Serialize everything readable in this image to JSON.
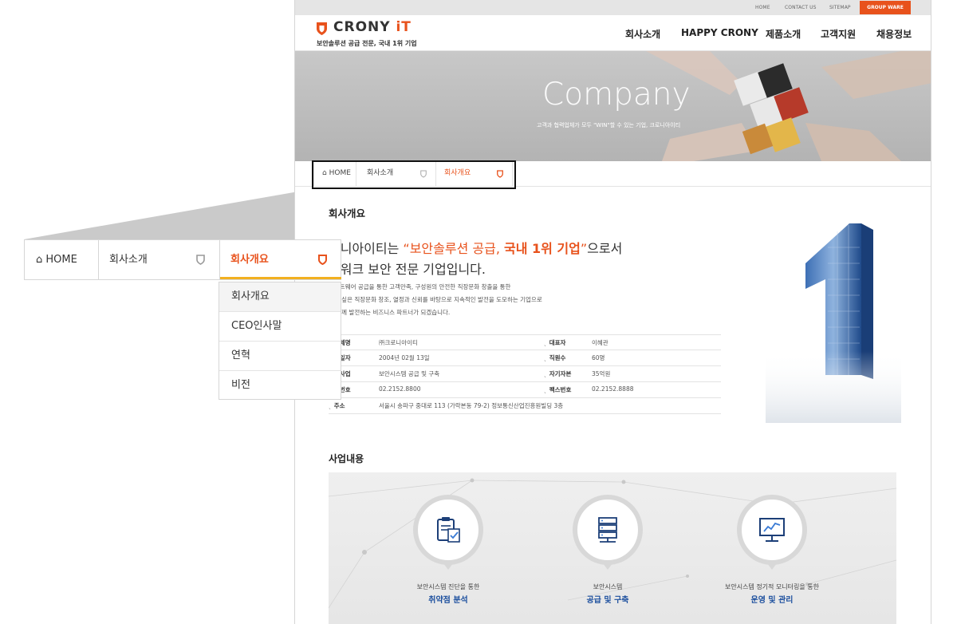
{
  "util": {
    "home": "HOME",
    "contact": "CONTACT US",
    "sitemap": "SITEMAP",
    "group_ware": "GROUP WARE"
  },
  "logo": {
    "name_main": "CRONY ",
    "name_it": "iT",
    "tagline": "보안솔루션 공급 전문, 국내 1위 기업"
  },
  "gnb": [
    "회사소개",
    "HAPPY CRONY",
    "제품소개",
    "고객지원",
    "채용정보"
  ],
  "hero": {
    "title": "Company",
    "subtitle": "고객과 협력업체가 모두 \"WIN\"할 수 있는 기업, 크로니아이티"
  },
  "breadcrumb": {
    "home": "HOME",
    "level1": "회사소개",
    "level2": "회사개요"
  },
  "dropdown": [
    "회사개요",
    "CEO인사말",
    "연혁",
    "비전"
  ],
  "content": {
    "title": "회사개요",
    "headline_pre": "로니아이티는 ",
    "headline_q1": "“보안솔루션 공급, ",
    "headline_bold": "국내 1위 기업",
    "headline_q2": "”",
    "headline_post": "으로서",
    "headline_line2": "트워크 보안 전문 기업입니다.",
    "desc1": "소프트웨어 공급을 통한 고객만족, 구성원의  안전한 직장문화 창출을 통한",
    "desc2": "하고 싶은 직장문화 창조, 열정과 신뢰를 바탕으로 지속적인 발전을 도모하는 기업으로",
    "desc3": "과 함께 발전하는 비즈니스 파트너가 되겠습니다."
  },
  "info": {
    "company_label": "기업체명",
    "company_value": "㈜크로니아이티",
    "ceo_label": "대표자",
    "ceo_value": "이혜관",
    "founded_label": "설립일자",
    "founded_value": "2004년 02월 13일",
    "staff_label": "직원수",
    "staff_value": "60명",
    "business_label": "주요사업",
    "business_value": "보안시스템 공급 및 구축",
    "capital_label": "자기자본",
    "capital_value": "35억원",
    "phone_label": "전화번호",
    "phone_value": "02.2152.8800",
    "fax_label": "팩스번호",
    "fax_value": "02.2152.8888",
    "address_label": "주소",
    "address_value": "서울시 송파구 중대로 113 (가락본동 79-2) 정보통신산업진흥원빌딩 3층"
  },
  "business": {
    "title": "사업내용",
    "items": [
      {
        "sub": "보안시스템 진단을 통한",
        "main": "취약점 분석",
        "icon": "clipboard-check-icon"
      },
      {
        "sub": "보안시스템",
        "main": "공급 및 구축",
        "icon": "server-icon"
      },
      {
        "sub": "보안시스템 정기적 모니터링을 통한",
        "main": "운영 및 관리",
        "icon": "monitor-chart-icon"
      }
    ]
  },
  "colors": {
    "accent": "#e8521c",
    "underline": "#f2b020",
    "blue": "#1c4f9e"
  }
}
